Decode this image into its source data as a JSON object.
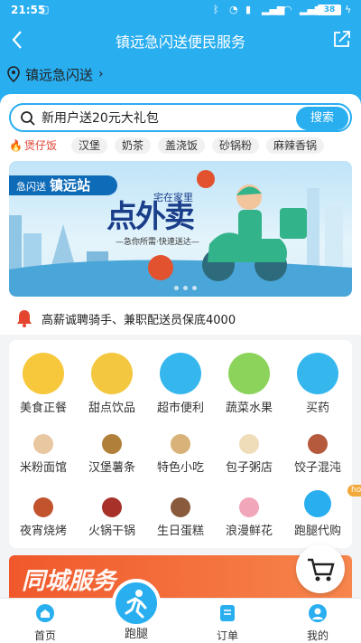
{
  "status": {
    "time": "21:55",
    "battery": "38"
  },
  "header": {
    "title": "镇远急闪送便民服务",
    "location": "镇远急闪送"
  },
  "search": {
    "placeholder": "新用户送20元大礼包",
    "button": "搜索"
  },
  "tags": [
    "煲仔饭",
    "汉堡",
    "奶茶",
    "盖浇饭",
    "砂锅粉",
    "麻辣香锅"
  ],
  "banner": {
    "brand_a": "急闪送",
    "brand_b": "镇远站",
    "headline": "点外卖",
    "small": "宅在家里",
    "slogan": "—急你所需·快速送达—"
  },
  "notice": "高薪诚聘骑手、兼职配送员保底4000",
  "categories": [
    {
      "label": "美食正餐",
      "icon": "food-icon",
      "color": "#f7c83c"
    },
    {
      "label": "甜点饮品",
      "icon": "dessert-icon",
      "color": "#f3c73f"
    },
    {
      "label": "超市便利",
      "icon": "basket-icon",
      "color": "#35b7ee"
    },
    {
      "label": "蔬菜水果",
      "icon": "fruit-icon",
      "color": "#8cd35b"
    },
    {
      "label": "买药",
      "icon": "medicine-icon",
      "color": "#35b7ee"
    },
    {
      "label": "米粉面馆",
      "icon": "noodle-icon",
      "color": "#e9c7a0"
    },
    {
      "label": "汉堡薯条",
      "icon": "burger-icon",
      "color": "#b07f3a"
    },
    {
      "label": "特色小吃",
      "icon": "snack-icon",
      "color": "#d9b27a"
    },
    {
      "label": "包子粥店",
      "icon": "bun-icon",
      "color": "#eeddb8"
    },
    {
      "label": "饺子混沌",
      "icon": "dumpling-icon",
      "color": "#b65a3d"
    },
    {
      "label": "夜宵烧烤",
      "icon": "bbq-icon",
      "color": "#c1532d"
    },
    {
      "label": "火锅干锅",
      "icon": "hotpot-icon",
      "color": "#a8322a"
    },
    {
      "label": "生日蛋糕",
      "icon": "cake-icon",
      "color": "#8a5a3c"
    },
    {
      "label": "浪漫鲜花",
      "icon": "flower-icon",
      "color": "#f2a6b9"
    },
    {
      "label": "跑腿代购",
      "icon": "errand-icon",
      "color": "#29aef0",
      "badge": "hot"
    }
  ],
  "promo": {
    "title": "同城服务"
  },
  "tabbar": {
    "home": "首页",
    "errand": "跑腿",
    "orders": "订单",
    "mine": "我的"
  },
  "colors": {
    "primary": "#29aef0",
    "hot_red": "#e04a3a"
  }
}
